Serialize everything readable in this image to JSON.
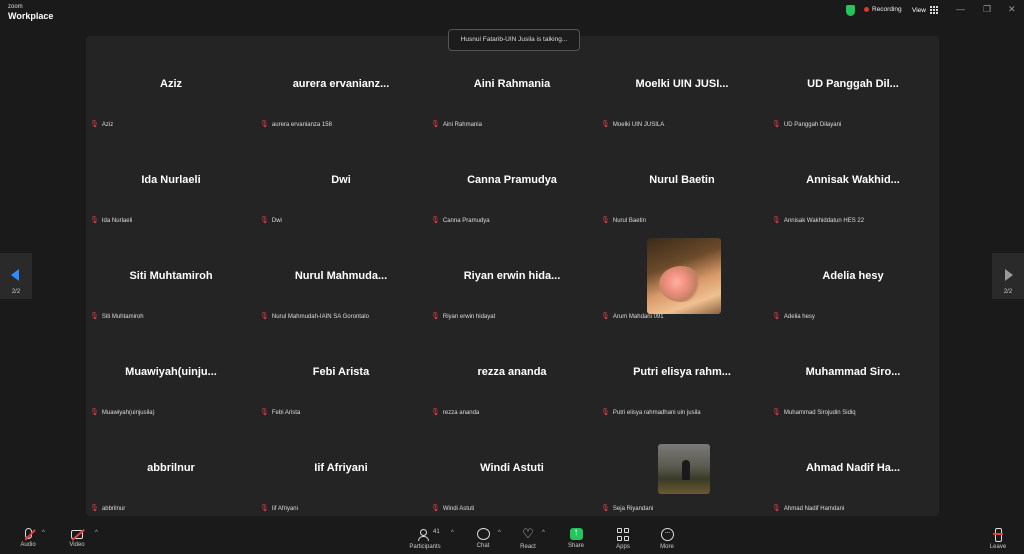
{
  "app": {
    "brand_small": "zoom",
    "brand_big": "Workplace"
  },
  "topbar": {
    "recording": "Recording",
    "view": "View",
    "minimize": "—",
    "maximize": "❐",
    "close": "✕"
  },
  "banner": "Husnul Fatarib-UIN Jusila is talking...",
  "colors": {
    "accent": "#2d8cff",
    "muted": "#e04040",
    "share": "#23c55e",
    "record": "#e03535"
  },
  "participants": [
    {
      "name": "Aziz",
      "label": "Aziz"
    },
    {
      "name": "aurera ervanianz...",
      "label": "aurera ervanianza 158"
    },
    {
      "name": "Aini Rahmania",
      "label": "Aini Rahmania"
    },
    {
      "name": "Moelki UIN JUSI...",
      "label": "Moelki UIN JUSILA"
    },
    {
      "name": "UD Panggah Dil...",
      "label": "UD Panggah Dilayani"
    },
    {
      "name": "Ida Nurlaeli",
      "label": "Ida Nurlaeli"
    },
    {
      "name": "Dwi",
      "label": "Dwi"
    },
    {
      "name": "Canna Pramudya",
      "label": "Canna Pramudya"
    },
    {
      "name": "Nurul Baetin",
      "label": "Nurul Baetin"
    },
    {
      "name": "Annisak Wakhid...",
      "label": "Annisak Wakhiddatun HES 22"
    },
    {
      "name": "Siti Muhtamiroh",
      "label": "Siti Muhtamiroh"
    },
    {
      "name": "Nurul Mahmuda...",
      "label": "Nurul Mahmudah-IAIN SA Gorontalo"
    },
    {
      "name": "Riyan erwin hida...",
      "label": "Riyan erwin hidayat"
    },
    {
      "name": "",
      "label": "Arum Mahdani 091"
    },
    {
      "name": "Adelia hesy",
      "label": "Adelia hesy"
    },
    {
      "name": "Muawiyah(uinju...",
      "label": "Muawiyah(uinjusila)"
    },
    {
      "name": "Febi Arista",
      "label": "Febi Arista"
    },
    {
      "name": "rezza ananda",
      "label": "rezza ananda"
    },
    {
      "name": "Putri elisya rahm...",
      "label": "Putri elisya rahmadhani uin jusila"
    },
    {
      "name": "Muhammad Siro...",
      "label": "Muhammad Sirojudin Sidiq"
    },
    {
      "name": "abbrilnur",
      "label": "abbrilnur"
    },
    {
      "name": "Iif Afriyani",
      "label": "Iif Afriyani"
    },
    {
      "name": "Windi Astuti",
      "label": "Windi Astuti"
    },
    {
      "name": "",
      "label": "Seja Riyandani"
    },
    {
      "name": "Ahmad Nadif Ha...",
      "label": "Ahmad Nadif Hamdani"
    }
  ],
  "pager": {
    "left": "2/2",
    "right": "2/2"
  },
  "toolbar": {
    "audio": "Audio",
    "video": "Video",
    "participants": "Participants",
    "participants_count": "41",
    "chat": "Chat",
    "react": "React",
    "share": "Share",
    "apps": "Apps",
    "more": "More",
    "leave": "Leave"
  }
}
